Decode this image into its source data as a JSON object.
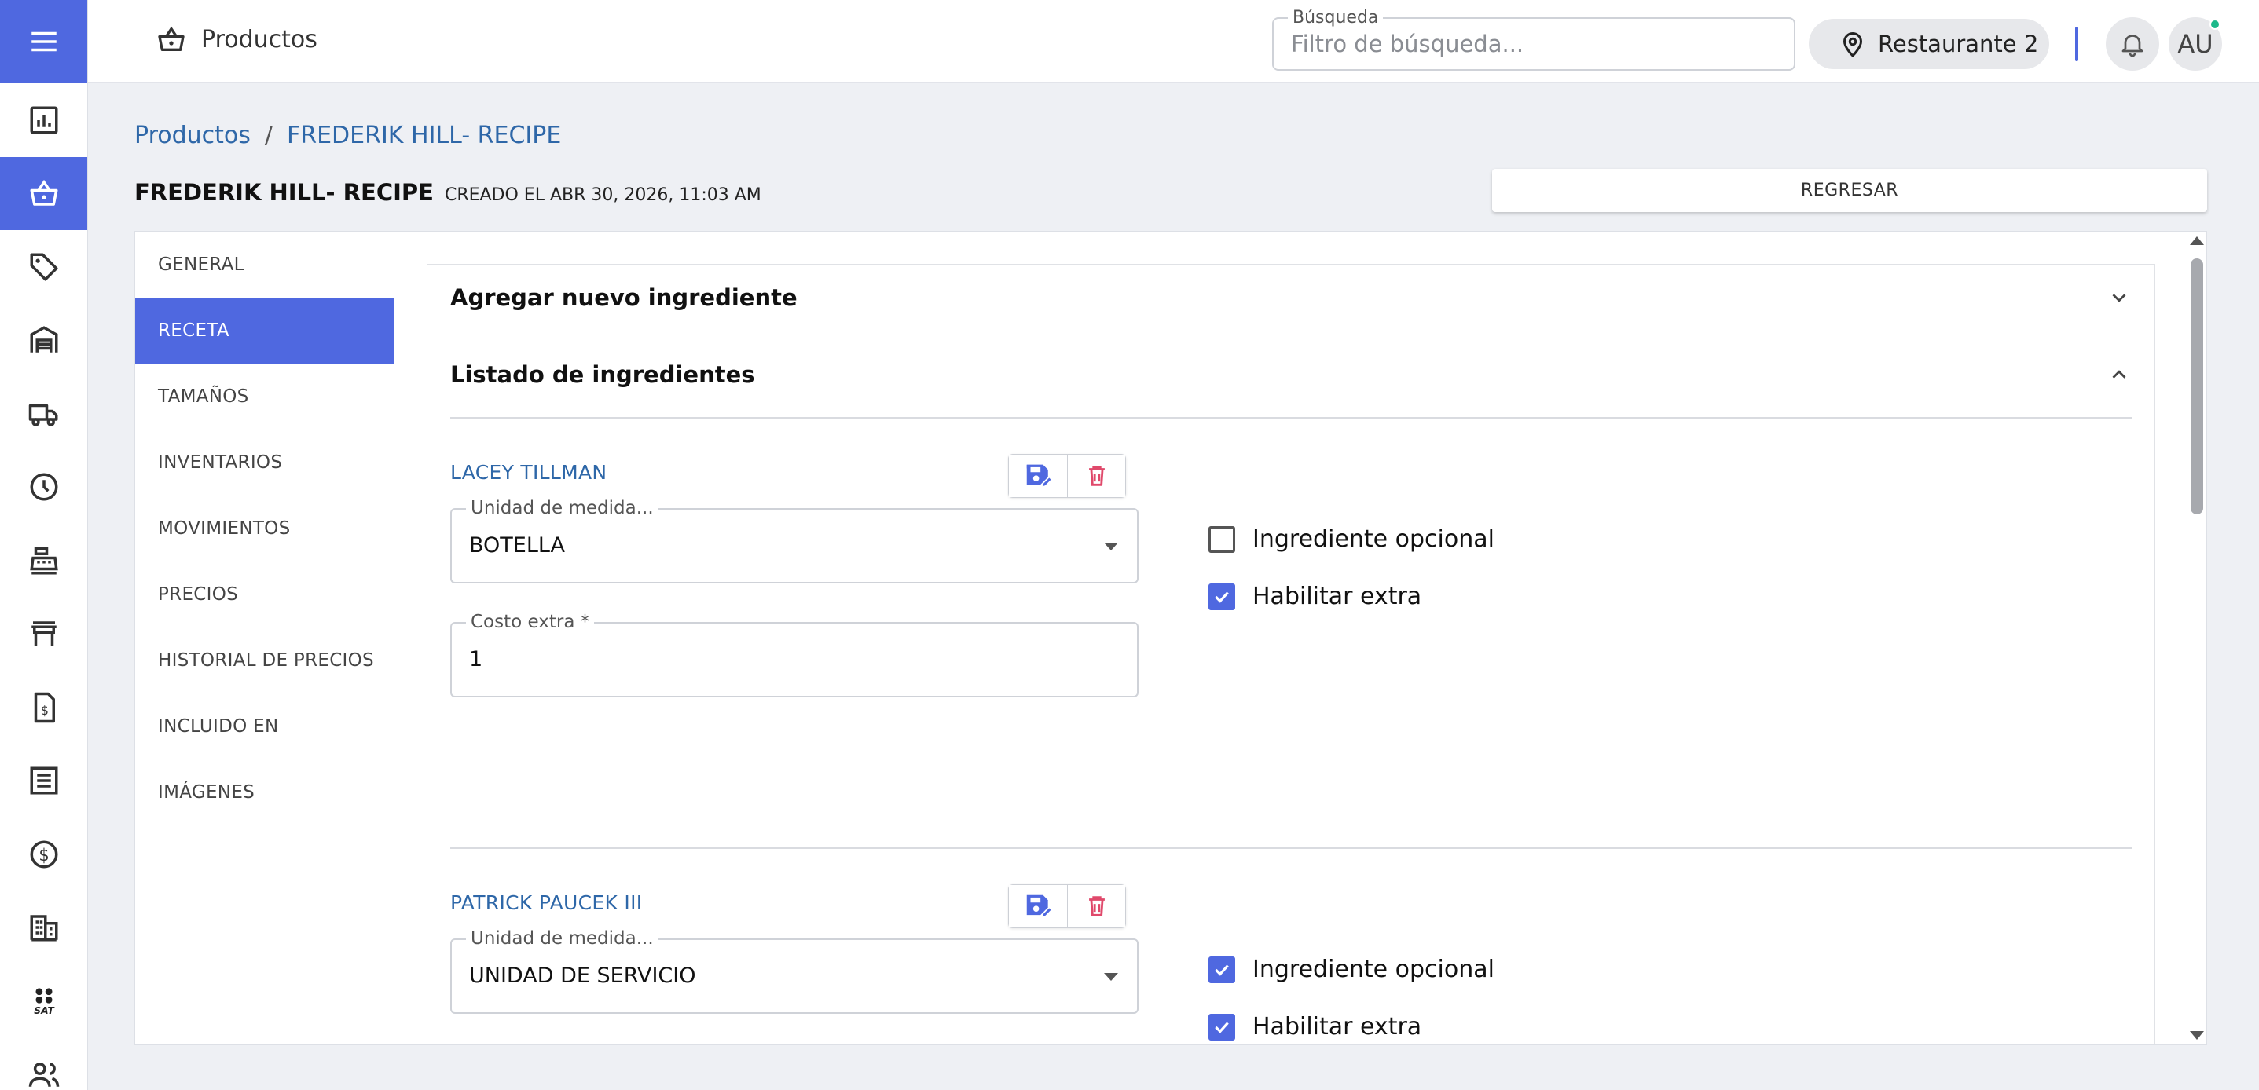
{
  "topbar": {
    "title": "Productos",
    "search_label": "Búsqueda",
    "search_placeholder": "Filtro de búsqueda...",
    "location": "Restaurante 2",
    "avatar_initials": "AU"
  },
  "breadcrumb": {
    "root": "Productos",
    "separator": "/",
    "current": "FREDERIK HILL- RECIPE"
  },
  "page": {
    "title": "FREDERIK HILL- RECIPE",
    "created": "CREADO EL ABR 30, 2026, 11:03 AM",
    "back_label": "REGRESAR"
  },
  "tabs": [
    "GENERAL",
    "RECETA",
    "TAMAÑOS",
    "INVENTARIOS",
    "MOVIMIENTOS",
    "PRECIOS",
    "HISTORIAL DE PRECIOS",
    "INCLUIDO EN",
    "IMÁGENES"
  ],
  "active_tab": "RECETA",
  "accordion": {
    "add_title": "Agregar nuevo ingrediente",
    "list_title": "Listado de ingredientes"
  },
  "ingredients": [
    {
      "name": "LACEY TILLMAN",
      "unit_label": "Unidad de medida...",
      "unit_value": "BOTELLA",
      "cost_label": "Costo extra *",
      "cost_value": "1",
      "optional_label": "Ingrediente opcional",
      "optional_checked": false,
      "extra_label": "Habilitar extra",
      "extra_checked": true
    },
    {
      "name": "PATRICK PAUCEK III",
      "unit_label": "Unidad de medida...",
      "unit_value": "UNIDAD DE SERVICIO",
      "optional_label": "Ingrediente opcional",
      "optional_checked": true,
      "extra_label": "Habilitar extra",
      "extra_checked": true
    }
  ],
  "colors": {
    "accent": "#4f68e0",
    "link": "#2e67a8",
    "delete": "#e0496b",
    "online": "#1cb88a"
  }
}
